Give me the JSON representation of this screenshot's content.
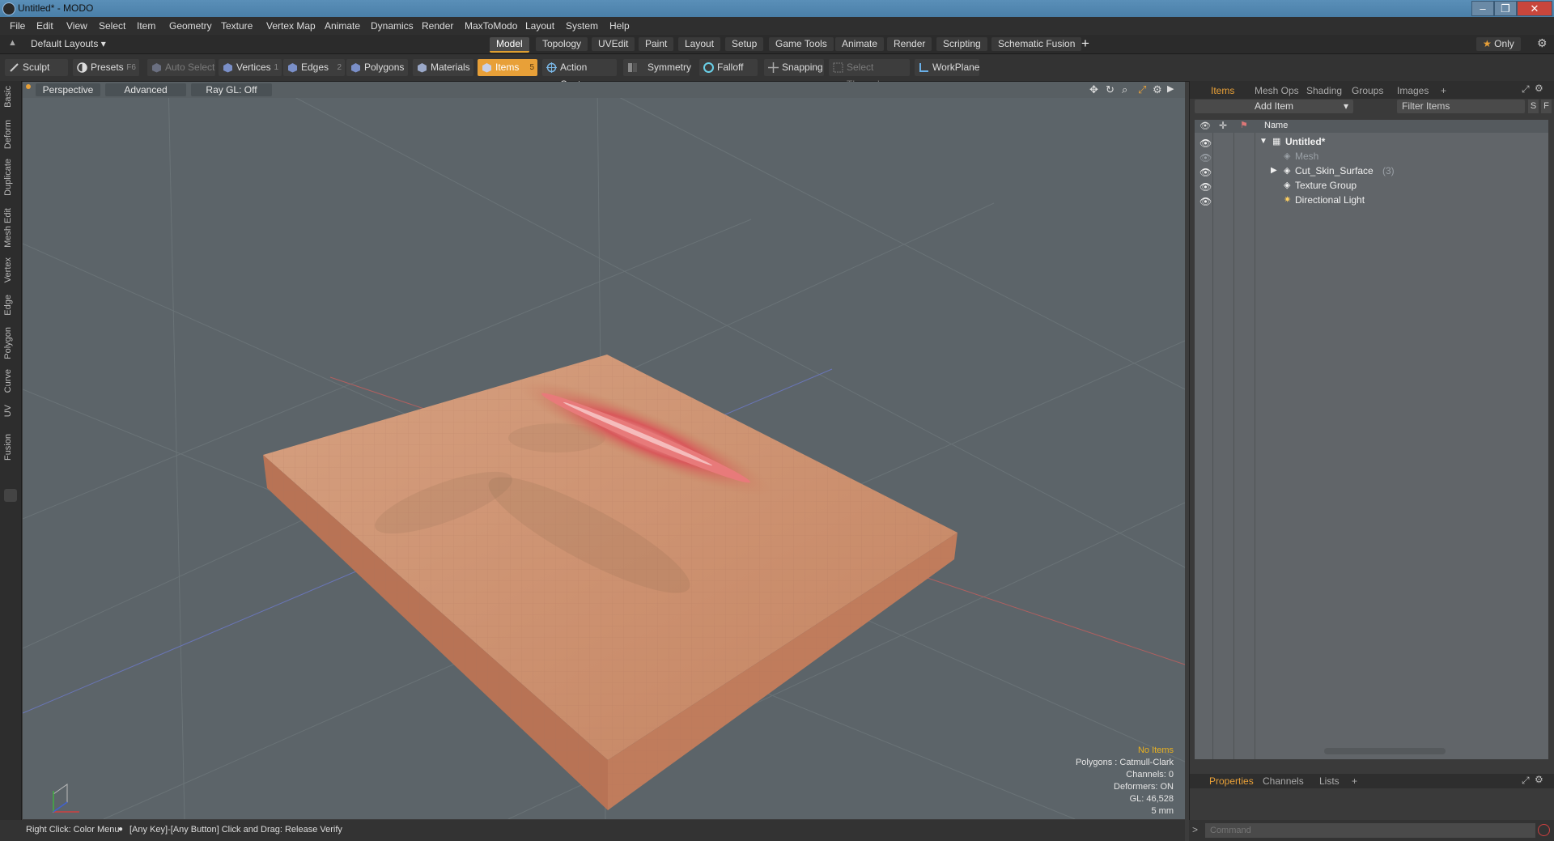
{
  "window": {
    "title": "Untitled* - MODO"
  },
  "menu": [
    "File",
    "Edit",
    "View",
    "Select",
    "Item",
    "Geometry",
    "Texture",
    "Vertex Map",
    "Animate",
    "Dynamics",
    "Render",
    "MaxToModo",
    "Layout",
    "System",
    "Help"
  ],
  "layoutbar": {
    "layouts_label": "Default Layouts",
    "tabs": [
      "Model",
      "Topology",
      "UVEdit",
      "Paint",
      "Layout",
      "Setup",
      "Game Tools",
      "Animate",
      "Render",
      "Scripting",
      "Schematic Fusion"
    ],
    "add": "+",
    "only": "Only"
  },
  "toolbar": {
    "sculpt": "Sculpt",
    "presets": "Presets",
    "presets_key": "F6",
    "auto_select": "Auto Select",
    "vertices": "Vertices",
    "vertices_key": "1",
    "edges": "Edges",
    "edges_key": "2",
    "polygons": "Polygons",
    "materials": "Materials",
    "items": "Items",
    "items_key": "5",
    "action_center": "Action Center",
    "symmetry": "Symmetry",
    "falloff": "Falloff",
    "snapping": "Snapping",
    "select_through": "Select Through",
    "workplane": "WorkPlane"
  },
  "left_tabs": [
    "Basic",
    "Deform",
    "Duplicate",
    "Mesh Edit",
    "Vertex",
    "Edge",
    "Polygon",
    "Curve",
    "UV",
    "Fusion"
  ],
  "viewport": {
    "view": "Perspective",
    "advanced": "Advanced",
    "raygl": "Ray GL: Off",
    "info": {
      "no_items": "No Items",
      "polygons": "Polygons : Catmull-Clark",
      "channels": "Channels: 0",
      "deformers": "Deformers: ON",
      "gl": "GL: 46,528",
      "scale": "5 mm"
    }
  },
  "items_panel": {
    "tabs": [
      "Items",
      "Mesh Ops",
      "Shading",
      "Groups",
      "Images"
    ],
    "add_tab": "+",
    "add_item": "Add Item",
    "filter": "Filter Items",
    "filter_s": "S",
    "filter_f": "F",
    "col_name": "Name",
    "tree": [
      {
        "label": "Untitled*",
        "count": ""
      },
      {
        "label": "Mesh",
        "count": ""
      },
      {
        "label": "Cut_Skin_Surface",
        "count": "(3)"
      },
      {
        "label": "Texture Group",
        "count": ""
      },
      {
        "label": "Directional Light",
        "count": ""
      }
    ]
  },
  "props_panel": {
    "tabs": [
      "Properties",
      "Channels",
      "Lists"
    ],
    "add_tab": "+"
  },
  "status": {
    "hint_a": "Right Click: Color Menu",
    "hint_b": "[Any Key]-[Any Button] Click and Drag: Release Verify",
    "command_placeholder": "Command",
    "prompt": ">"
  },
  "colors": {
    "accent": "#e8a038",
    "viewport_bg": "#5c6469",
    "skin": "#c98a66",
    "wound": "#d25a5a"
  }
}
